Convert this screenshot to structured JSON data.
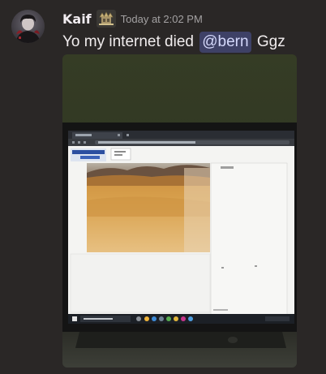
{
  "message": {
    "author": "Kaif",
    "badge_icon": "king-crown-icon",
    "timestamp": "Today at 2:02 PM",
    "text_before": "Yo my internet died",
    "mention": "@bern",
    "text_after": "Ggz"
  },
  "colors": {
    "background": "#2a2726",
    "author": "#f1ecf0",
    "text": "#f0eced",
    "timestamp": "#a3a1a2",
    "mention_bg": "#3e4166",
    "mention_text": "#d4d8fb"
  },
  "attachment": {
    "kind": "photo-of-laptop-screen",
    "screen": {
      "site_logo": "GOLDEN SUN",
      "taskbar_search": "Type here to search"
    }
  }
}
